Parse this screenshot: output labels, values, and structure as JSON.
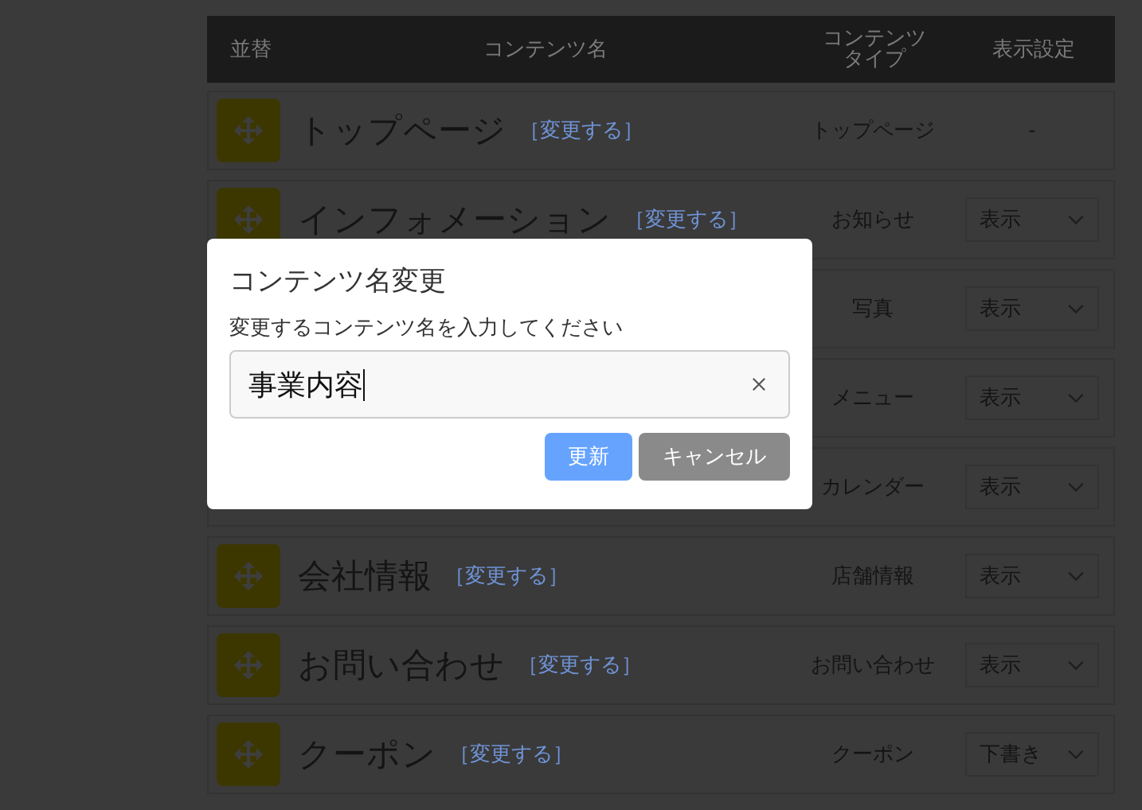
{
  "table": {
    "columns": [
      "並替",
      "コンテンツ名",
      "コンテンツタイプ",
      "表示設定"
    ],
    "rows": [
      {
        "name": "トップページ",
        "link": "［変更する］",
        "type": "トップページ",
        "setting": {
          "kind": "text",
          "value": "-"
        }
      },
      {
        "name": "インフォメーション",
        "link": "［変更する］",
        "type": "お知らせ",
        "setting": {
          "kind": "select",
          "value": "表示"
        }
      },
      {
        "type": "写真",
        "setting": {
          "kind": "select",
          "value": "表示"
        }
      },
      {
        "type": "メニュー",
        "setting": {
          "kind": "select",
          "value": "表示"
        }
      },
      {
        "type": "カレンダー",
        "setting": {
          "kind": "select",
          "value": "表示"
        }
      },
      {
        "name": "会社情報",
        "link": "［変更する］",
        "type": "店舗情報",
        "setting": {
          "kind": "select",
          "value": "表示"
        }
      },
      {
        "name": "お問い合わせ",
        "link": "［変更する］",
        "type": "お問い合わせ",
        "setting": {
          "kind": "select",
          "value": "表示"
        }
      },
      {
        "name": "クーポン",
        "link": "［変更する］",
        "type": "クーポン",
        "setting": {
          "kind": "select",
          "value": "下書き"
        }
      }
    ]
  },
  "dialog": {
    "title": "コンテンツ名変更",
    "label": "変更するコンテンツ名を入力してください",
    "value": "事業内容",
    "buttons": [
      {
        "label": "更新",
        "kind": "primary"
      },
      {
        "label": "キャンセル",
        "kind": "secondary"
      }
    ]
  }
}
